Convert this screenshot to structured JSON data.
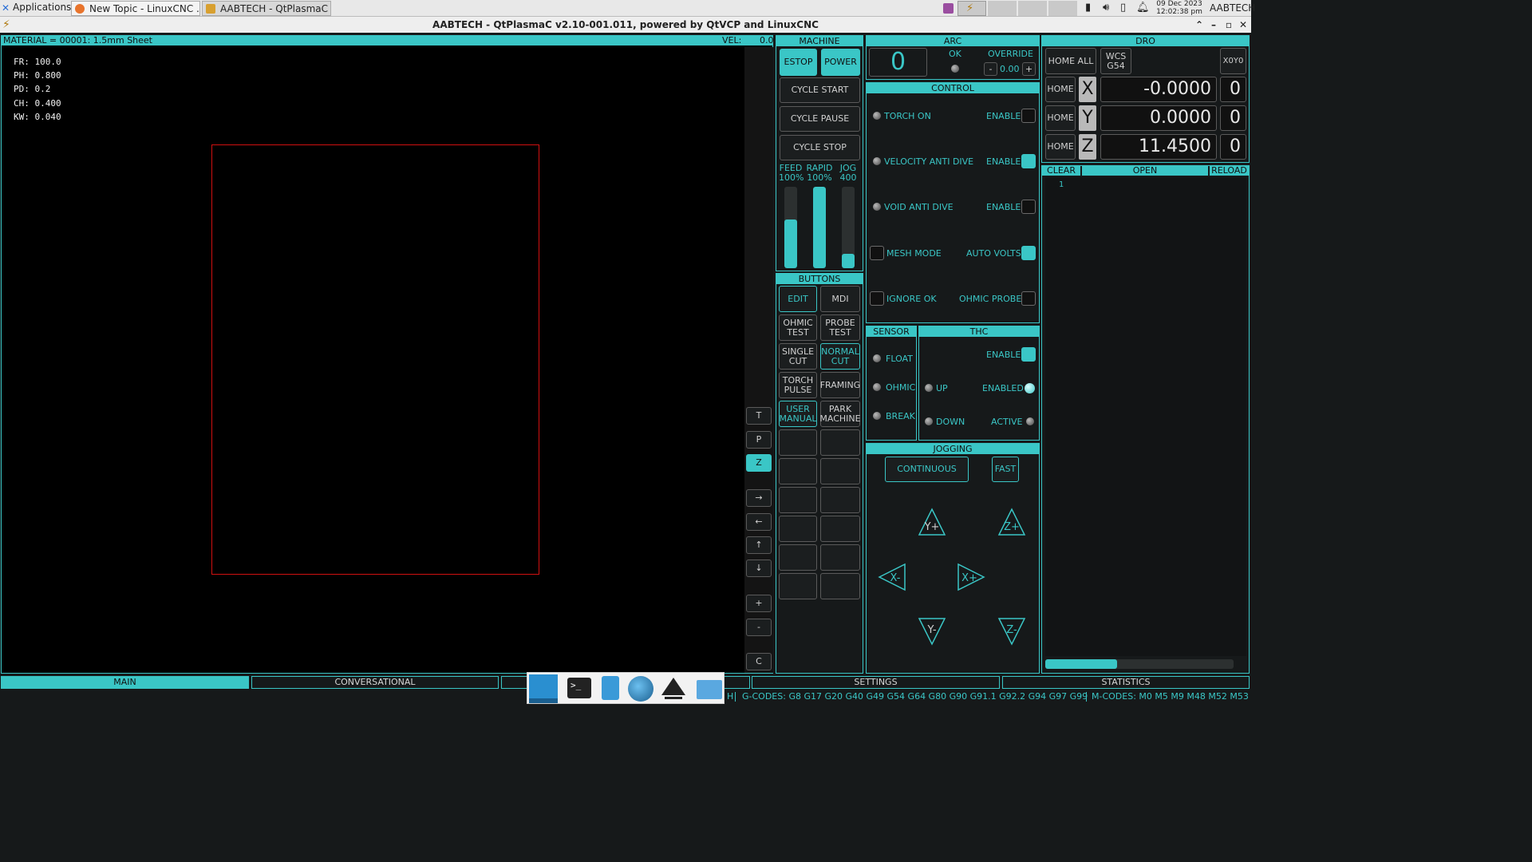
{
  "taskbar": {
    "applications_label": "Applications",
    "tabs": [
      "New Topic - LinuxCNC ...",
      "AABTECH - QtPlasmaC ..."
    ],
    "date": "09 Dec 2023",
    "time": "12:02:38 pm",
    "user": "AABTECH"
  },
  "window": {
    "title": "AABTECH - QtPlasmaC v2.10-001.011, powered by QtVCP and LinuxCNC"
  },
  "preview": {
    "material": "MATERIAL =  00001: 1.5mm Sheet",
    "vel_label": "VEL:",
    "vel_value": "0.0",
    "params": [
      "FR: 100.0",
      "PH: 0.800",
      "PD: 0.2",
      "CH: 0.400",
      "KW: 0.040"
    ],
    "side_buttons": [
      "T",
      "P",
      "Z",
      "→",
      "←",
      "↑",
      "↓",
      "+",
      "-",
      "C"
    ],
    "cut_color": "#d01010"
  },
  "machine": {
    "title": "MACHINE",
    "estop": "ESTOP",
    "power": "POWER",
    "cycle_start": "CYCLE START",
    "cycle_pause": "CYCLE PAUSE",
    "cycle_stop": "CYCLE STOP",
    "sliders": [
      {
        "name": "FEED",
        "value": "100%",
        "level": 0.6
      },
      {
        "name": "RAPID",
        "value": "100%",
        "level": 1.0
      },
      {
        "name": "JOG",
        "value": "400",
        "level": 0.18
      }
    ]
  },
  "buttons_panel": {
    "title": "BUTTONS",
    "items": [
      "EDIT",
      "MDI",
      "OHMIC TEST",
      "PROBE TEST",
      "SINGLE CUT",
      "NORMAL CUT",
      "TORCH PULSE",
      "FRAMING",
      "USER MANUAL",
      "PARK MACHINE"
    ]
  },
  "arc": {
    "title": "ARC",
    "value": "0",
    "ok_label": "OK",
    "override_label": "OVERRIDE",
    "override_minus": "-",
    "override_value": "0.00",
    "override_plus": "+"
  },
  "control": {
    "title": "CONTROL",
    "rows": [
      {
        "label": "TORCH ON",
        "enable_label": "ENABLE",
        "enabled": false
      },
      {
        "label": "VELOCITY ANTI DIVE",
        "enable_label": "ENABLE",
        "enabled": true
      },
      {
        "label": "VOID ANTI DIVE",
        "enable_label": "ENABLE",
        "enabled": false
      }
    ],
    "mesh_mode": "MESH MODE",
    "auto_volts": "AUTO VOLTS",
    "ignore_ok": "IGNORE OK",
    "ohmic_probe": "OHMIC PROBE"
  },
  "sensor": {
    "title": "SENSOR",
    "items": [
      "FLOAT",
      "OHMIC",
      "BREAK"
    ]
  },
  "thc": {
    "title": "THC",
    "enable": "ENABLE",
    "up": "UP",
    "enabled": "ENABLED",
    "down": "DOWN",
    "active": "ACTIVE"
  },
  "jogging": {
    "title": "JOGGING",
    "continuous": "CONTINUOUS",
    "fast": "FAST",
    "y_plus": "Y+",
    "z_plus": "Z+",
    "x_minus": "X-",
    "x_plus": "X+",
    "y_minus": "Y-",
    "z_minus": "Z-"
  },
  "dro": {
    "title": "DRO",
    "home_all": "HOME ALL",
    "wcs": "WCS G54",
    "x0y0": "X0Y0",
    "axes": [
      {
        "home": "HOME",
        "axis": "X",
        "value": "-0.0000",
        "touch": "0"
      },
      {
        "home": "HOME",
        "axis": "Y",
        "value": "0.0000",
        "touch": "0"
      },
      {
        "home": "HOME",
        "axis": "Z",
        "value": "11.4500",
        "touch": "0"
      }
    ]
  },
  "gcode": {
    "clear": "CLEAR",
    "open": "OPEN",
    "reload": "RELOAD",
    "line_number": "1"
  },
  "tabs": [
    "MAIN",
    "CONVERSATIONAL",
    "SETTINGS",
    "STATISTICS"
  ],
  "status": {
    "h": "H",
    "gcodes": "G-CODES:  G8 G17 G20 G40 G49 G54 G64 G80 G90 G91.1 G92.2 G94 G97 G99",
    "mcodes": "M-CODES:  M0 M5 M9 M48 M52 M53"
  },
  "colors": {
    "accent": "#3ac6c6",
    "background": "#16191a"
  }
}
